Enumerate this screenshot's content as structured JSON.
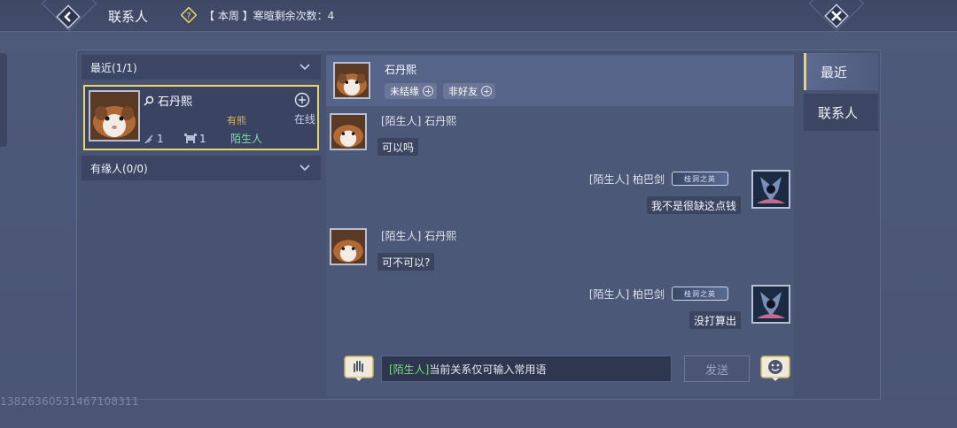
{
  "header": {
    "title": "联系人",
    "weekly_note": "【 本周 】寒暄剩余次数：4"
  },
  "contacts": {
    "groups": [
      {
        "label": "最近(1/1)"
      },
      {
        "label": "有缘人(0/0)"
      }
    ],
    "card": {
      "name": "石丹熙",
      "status": "在线",
      "tag": "有熊",
      "stat_a": "1",
      "stat_b": "1",
      "relation": "陌生人"
    }
  },
  "chat": {
    "header": {
      "name": "石丹熙",
      "pills": [
        "未结缘",
        "非好友"
      ]
    },
    "messages": [
      {
        "sender": "[陌生人] 石丹熙",
        "text": "可以吗",
        "side": "left"
      },
      {
        "sender": "[陌生人] 柏巴剑",
        "badge": "桂洞之英",
        "text": "我不是很缺这点钱",
        "side": "right"
      },
      {
        "sender": "[陌生人] 石丹熙",
        "text": "可不可以?",
        "side": "left"
      },
      {
        "sender": "[陌生人] 柏巴剑",
        "badge": "桂洞之英",
        "text": "没打算出",
        "side": "right"
      }
    ],
    "input": {
      "prefix": "[陌生人]",
      "placeholder": "当前关系仅可输入常用语",
      "send_label": "发送"
    }
  },
  "side_tabs": [
    {
      "label": "最近",
      "active": true
    },
    {
      "label": "联系人",
      "active": false
    }
  ],
  "watermark": "13826360531467108311",
  "colors": {
    "accent_yellow": "#e8d66a",
    "relation_green": "#79e0a8",
    "input_tag_green": "#6fe07a",
    "tag_gold": "#d6b25a"
  },
  "icons": {
    "back": "back-chevron-icon",
    "close": "close-x-icon",
    "weekly": "diamond-question-icon",
    "search": "magnifier-icon",
    "voice": "voice-hand-icon",
    "emoji": "smiley-icon"
  }
}
